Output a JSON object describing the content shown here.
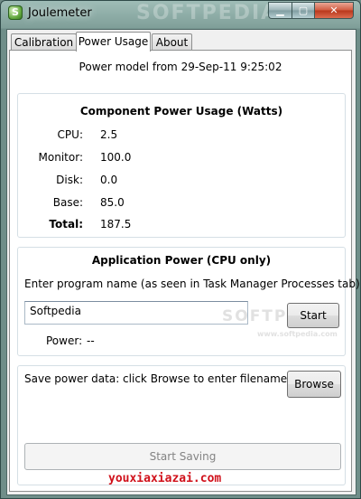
{
  "window": {
    "title": "Joulemeter",
    "icon_glyph": "S",
    "minimize_glyph": "▁",
    "maximize_glyph": "▢",
    "close_glyph": "✕"
  },
  "tabs": [
    {
      "label": "Calibration",
      "active": false
    },
    {
      "label": "Power Usage",
      "active": true
    },
    {
      "label": "About",
      "active": false
    }
  ],
  "power_model_text": "Power model from 29-Sep-11 9:25:02",
  "component_usage": {
    "title": "Component Power Usage (Watts)",
    "rows": [
      {
        "label": "CPU:",
        "value": "2.5"
      },
      {
        "label": "Monitor:",
        "value": "100.0"
      },
      {
        "label": "Disk:",
        "value": "0.0"
      },
      {
        "label": "Base:",
        "value": "85.0"
      },
      {
        "label": "Total:",
        "value": "187.5"
      }
    ]
  },
  "application_power": {
    "title": "Application Power (CPU only)",
    "prompt": "Enter program name (as seen in Task Manager Processes tab):",
    "program_value": "Softpedia",
    "start_label": "Start",
    "power_label": "Power:",
    "power_value": "--"
  },
  "save_section": {
    "text": "Save power data: click Browse to enter filename.",
    "browse_label": "Browse",
    "start_saving_label": "Start Saving"
  },
  "watermarks": {
    "title_watermark": "SOFTPEDIA",
    "input_watermark": "SOFTPEDIA",
    "url_watermark": "www.softpedia.com",
    "site_mark": "youxiaxiazai.com"
  }
}
